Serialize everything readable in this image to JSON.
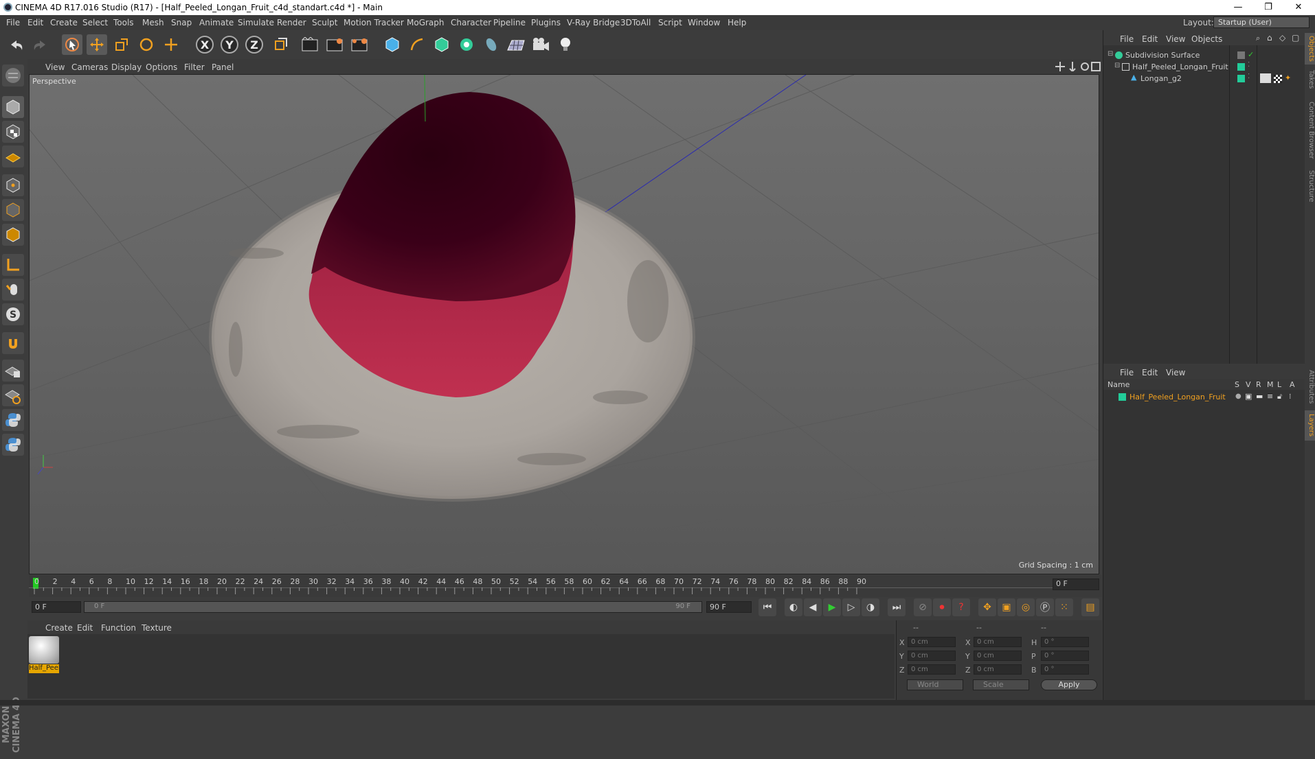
{
  "window": {
    "title": "CINEMA 4D R17.016 Studio (R17) - [Half_Peeled_Longan_Fruit_c4d_standart.c4d *] - Main",
    "minimize": "—",
    "restore": "❐",
    "close": "✕"
  },
  "menu": [
    "File",
    "Edit",
    "Create",
    "Select",
    "Tools",
    "Mesh",
    "Snap",
    "Animate",
    "Simulate",
    "Render",
    "Sculpt",
    "Motion Tracker",
    "MoGraph",
    "Character",
    "Pipeline",
    "Plugins",
    "V-Ray Bridge",
    "3DToAll",
    "Script",
    "Window",
    "Help"
  ],
  "layout": {
    "label": "Layout:",
    "value": "Startup (User)"
  },
  "viewport": {
    "menu": [
      "View",
      "Cameras",
      "Display",
      "Options",
      "Filter",
      "Panel"
    ],
    "label": "Perspective",
    "grid_spacing": "Grid Spacing : 1 cm"
  },
  "timeline": {
    "ticks": [
      "0",
      "2",
      "4",
      "6",
      "8",
      "10",
      "12",
      "14",
      "16",
      "18",
      "20",
      "22",
      "24",
      "26",
      "28",
      "30",
      "32",
      "34",
      "36",
      "38",
      "40",
      "42",
      "44",
      "46",
      "48",
      "50",
      "52",
      "54",
      "56",
      "58",
      "60",
      "62",
      "64",
      "66",
      "68",
      "70",
      "72",
      "74",
      "76",
      "78",
      "80",
      "82",
      "84",
      "86",
      "88",
      "90"
    ],
    "current_frame": "0 F",
    "start_field": "0 F",
    "range_start": "0 F",
    "range_end": "90 F",
    "end_field": "90 F"
  },
  "material_menu": [
    "Create",
    "Edit",
    "Function",
    "Texture"
  ],
  "material": {
    "label": "Half_Peel"
  },
  "coords": {
    "header": [
      "--",
      "--",
      "--"
    ],
    "rows": [
      {
        "a": "X",
        "av": "0 cm",
        "b": "X",
        "bv": "0 cm",
        "c": "H",
        "cv": "0 °"
      },
      {
        "a": "Y",
        "av": "0 cm",
        "b": "Y",
        "bv": "0 cm",
        "c": "P",
        "cv": "0 °"
      },
      {
        "a": "Z",
        "av": "0 cm",
        "b": "Z",
        "bv": "0 cm",
        "c": "B",
        "cv": "0 °"
      }
    ],
    "world": "World",
    "scale": "Scale",
    "apply": "Apply"
  },
  "object_manager": {
    "menu": [
      "File",
      "Edit",
      "View",
      "Objects"
    ],
    "items": [
      {
        "name": "Subdivision Surface",
        "color": "#9ab"
      },
      {
        "name": "Half_Peeled_Longan_Fruit",
        "color": "#2c9"
      },
      {
        "name": "Longan_g2",
        "color": "#2c9"
      }
    ]
  },
  "layer_manager": {
    "menu": [
      "File",
      "Edit",
      "View"
    ],
    "columns": [
      "Name",
      "S",
      "V",
      "R",
      "M",
      "L",
      "A"
    ],
    "layer": {
      "name": "Half_Peeled_Longan_Fruit",
      "color": "#2c9"
    }
  },
  "side_tabs": [
    "Objects",
    "Takes",
    "Content Browser",
    "Structure",
    "Attributes",
    "Layers"
  ],
  "brand": "MAXON CINEMA 4D"
}
